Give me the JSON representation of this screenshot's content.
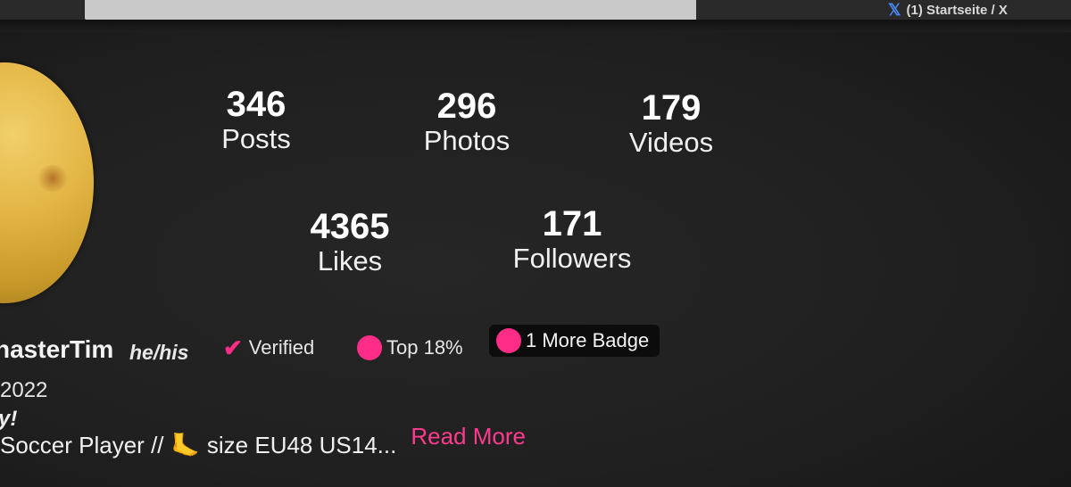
{
  "browser": {
    "x_tab_title": "(1) Startseite / X",
    "x_icon": "x-logo-icon"
  },
  "profile": {
    "avatar": "avatar",
    "username": "nasterTim",
    "pronouns": "he/his",
    "joined": "2022",
    "tagline": "y!",
    "bio_start": "Soccer Player //",
    "bio_icon": "foot-icon",
    "bio_end": "size EU48 US14...",
    "read_more": "Read More"
  },
  "stats": {
    "posts": {
      "value": "346",
      "label": "Posts"
    },
    "photos": {
      "value": "296",
      "label": "Photos"
    },
    "videos": {
      "value": "179",
      "label": "Videos"
    },
    "likes": {
      "value": "4365",
      "label": "Likes"
    },
    "followers": {
      "value": "171",
      "label": "Followers"
    }
  },
  "badges": {
    "verified": "Verified",
    "top": "Top 18%",
    "more": "1 More Badge"
  },
  "colors": {
    "accent": "#ff2d87",
    "background": "#202020",
    "text": "#ffffff"
  }
}
